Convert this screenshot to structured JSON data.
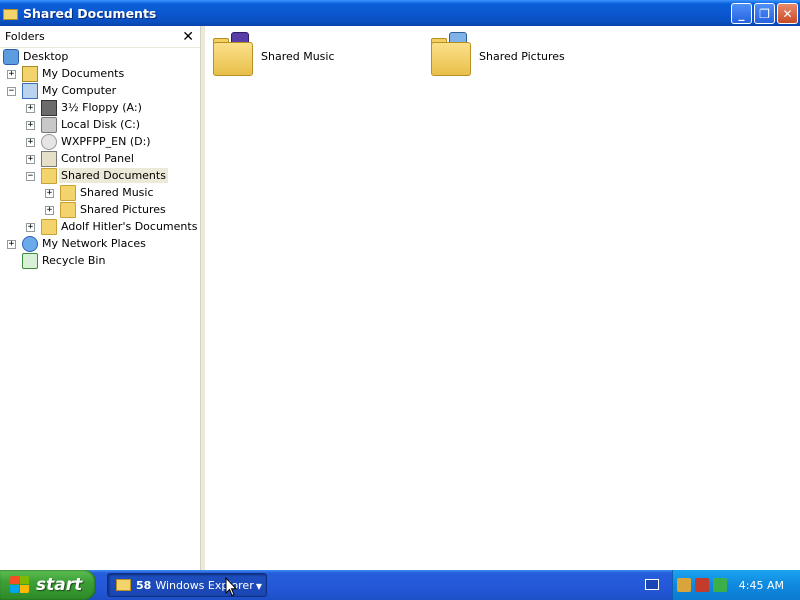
{
  "window": {
    "title": "Shared Documents",
    "buttons": {
      "minimize": "_",
      "maximize": "❐",
      "close": "✕"
    }
  },
  "folders_pane": {
    "title": "Folders",
    "close_glyph": "✕",
    "tree": [
      {
        "label": "Desktop",
        "icon": "desktop-icon",
        "expander": "",
        "depth": 0
      },
      {
        "label": "My Documents",
        "icon": "my-documents-icon",
        "expander": "+",
        "depth": 1
      },
      {
        "label": "My Computer",
        "icon": "my-computer-icon",
        "expander": "−",
        "depth": 1
      },
      {
        "label": "3½ Floppy (A:)",
        "icon": "floppy-drive-icon",
        "expander": "+",
        "depth": 2
      },
      {
        "label": "Local Disk (C:)",
        "icon": "hard-disk-icon",
        "expander": "+",
        "depth": 2
      },
      {
        "label": "WXPFPP_EN (D:)",
        "icon": "cd-drive-icon",
        "expander": "+",
        "depth": 2
      },
      {
        "label": "Control Panel",
        "icon": "control-panel-icon",
        "expander": "+",
        "depth": 2
      },
      {
        "label": "Shared Documents",
        "icon": "folder-icon",
        "expander": "−",
        "depth": 2,
        "selected": true
      },
      {
        "label": "Shared Music",
        "icon": "shared-music-folder-icon",
        "expander": "+",
        "depth": 3
      },
      {
        "label": "Shared Pictures",
        "icon": "shared-pictures-folder-icon",
        "expander": "+",
        "depth": 3
      },
      {
        "label": "Adolf Hitler's Documents",
        "icon": "folder-icon",
        "expander": "+",
        "depth": 2
      },
      {
        "label": "My Network Places",
        "icon": "network-places-icon",
        "expander": "+",
        "depth": 1
      },
      {
        "label": "Recycle Bin",
        "icon": "recycle-bin-icon",
        "expander": "",
        "depth": 1
      }
    ]
  },
  "content": {
    "items": [
      {
        "label": "Shared Music",
        "icon": "shared-music-folder-icon"
      },
      {
        "label": "Shared Pictures",
        "icon": "shared-pictures-folder-icon"
      }
    ]
  },
  "taskbar": {
    "start_label": "start",
    "task_button": {
      "count": "58",
      "label": "Windows Explorer"
    },
    "clock": "4:45 AM"
  },
  "colors": {
    "title_bar": "#0b58d0",
    "taskbar": "#245edb",
    "start_button": "#3c9f35",
    "tray": "#0f89e0",
    "selection": "#ece9d8"
  }
}
